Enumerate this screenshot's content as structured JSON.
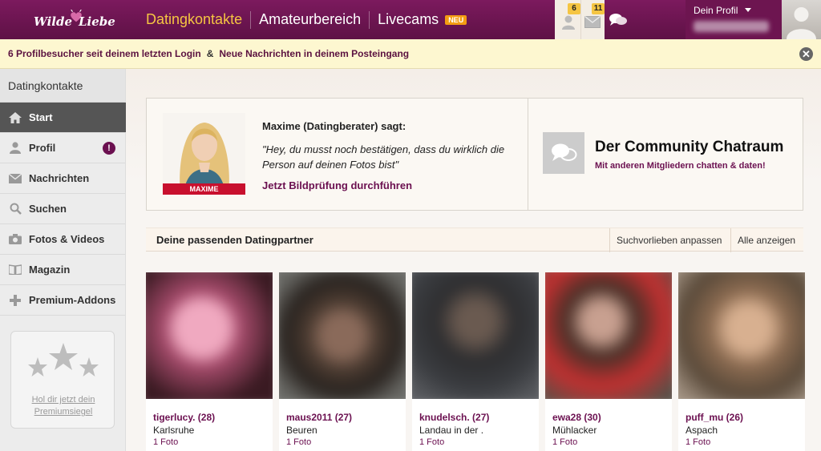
{
  "header": {
    "logo_left": "Wilde",
    "logo_right": "Liebe",
    "nav": [
      {
        "label": "Datingkontakte",
        "active": true
      },
      {
        "label": "Amateurbereich",
        "active": false
      },
      {
        "label": "Livecams",
        "active": false
      }
    ],
    "neu_badge": "NEU",
    "visitor_count": "6",
    "message_count": "11",
    "profile_label": "Dein Profil"
  },
  "notice": {
    "visitors_text": "6 Profilbesucher seit deinem letzten Login",
    "amp": "&",
    "messages_text": "Neue Nachrichten in deinem Posteingang",
    "close_glyph": "✕"
  },
  "sidebar": {
    "title": "Datingkontakte",
    "items": [
      {
        "label": "Start",
        "icon": "home-icon",
        "active": true
      },
      {
        "label": "Profil",
        "icon": "user-icon"
      },
      {
        "label": "Nachrichten",
        "icon": "envelope-icon"
      },
      {
        "label": "Suchen",
        "icon": "search-icon"
      },
      {
        "label": "Fotos & Videos",
        "icon": "camera-icon"
      },
      {
        "label": "Magazin",
        "icon": "book-icon"
      },
      {
        "label": "Premium-Addons",
        "icon": "plus-icon"
      }
    ],
    "profile_alert": "!",
    "premium_link": "Hol dir jetzt dein Premiumsiegel"
  },
  "advisor": {
    "photo_label": "MAXIME",
    "title": "Maxime (Datingberater) sagt:",
    "quote": "\"Hey, du musst noch bestätigen, dass du wirklich die Person auf deinen Fotos bist\"",
    "link": "Jetzt Bildprüfung durchführen"
  },
  "chatroom": {
    "title": "Der Community Chatraum",
    "subtitle": "Mit anderen Mitgliedern chatten & daten!"
  },
  "matches": {
    "title": "Deine passenden Datingpartner",
    "adjust_link": "Suchvorlieben anpassen",
    "all_link": "Alle anzeigen",
    "profiles": [
      {
        "name": "tigerlucy. (28)",
        "city": "Karlsruhe",
        "photos": "1 Foto"
      },
      {
        "name": "maus2011 (27)",
        "city": "Beuren",
        "photos": "1 Foto"
      },
      {
        "name": "knudelsch. (27)",
        "city": "Landau in der .",
        "photos": "1 Foto"
      },
      {
        "name": "ewa28 (30)",
        "city": "Mühlacker",
        "photos": "1 Foto"
      },
      {
        "name": "puff_mu (26)",
        "city": "Aspach",
        "photos": "1 Foto"
      }
    ]
  },
  "colors": {
    "brand": "#6b1050",
    "accent": "#f5c542",
    "notice_bg": "#fdf7d0"
  }
}
